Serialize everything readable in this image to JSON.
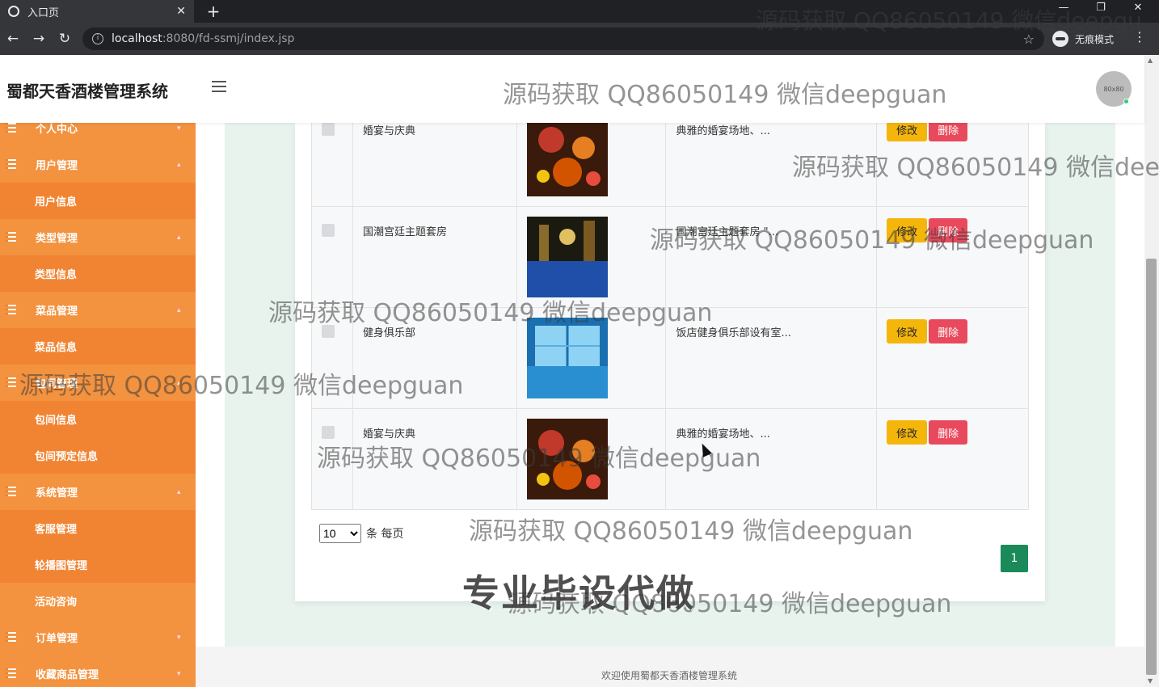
{
  "browser": {
    "tab_title": "入口页",
    "url_host": "localhost",
    "url_path": ":8080/fd-ssmj/index.jsp",
    "incognito_label": "无痕模式"
  },
  "header": {
    "brand": "蜀都天香酒楼管理系统",
    "avatar_text": "80x80"
  },
  "sidebar": {
    "groups": [
      {
        "label": "个人中心",
        "chevron": "▾"
      },
      {
        "label": "用户管理",
        "chevron": "▴",
        "items": [
          "用户信息"
        ]
      },
      {
        "label": "类型管理",
        "chevron": "▴",
        "items": [
          "类型信息"
        ]
      },
      {
        "label": "菜品管理",
        "chevron": "▴",
        "items": [
          "菜品信息"
        ]
      },
      {
        "label": "包间管理",
        "chevron": "▴",
        "items": [
          "包间信息",
          "包间预定信息"
        ]
      },
      {
        "label": "系统管理",
        "chevron": "▴",
        "items": [
          "客服管理",
          "轮播图管理",
          "活动咨询"
        ]
      },
      {
        "label": "订单管理",
        "chevron": "▾"
      },
      {
        "label": "收藏商品管理",
        "chevron": "▾"
      }
    ]
  },
  "table": {
    "rows": [
      {
        "name": "婚宴与庆典",
        "desc": "典雅的婚宴场地、...",
        "img": "wedding"
      },
      {
        "name": "国潮宫廷主题套房",
        "desc": "国潮宫廷主题套房 \"...",
        "img": "pool"
      },
      {
        "name": "健身俱乐部",
        "desc": "饭店健身俱乐部设有室...",
        "img": "gym"
      },
      {
        "name": "婚宴与庆典",
        "desc": "典雅的婚宴场地、...",
        "img": "wedding"
      }
    ],
    "edit_label": "修改",
    "delete_label": "删除"
  },
  "pagination": {
    "page_size": "10",
    "page_size_suffix": "条 每页",
    "current_page": "1"
  },
  "footer": {
    "text": "欢迎使用蜀都天香酒楼管理系统"
  },
  "watermarks": {
    "main": "源码获取 QQ86050149 微信deepguan",
    "partial_top": "源码获取 QQ86050149 微信deepgu",
    "partial_right": "源码获取 QQ86050149 微信deep",
    "big": "专业毕设代做"
  }
}
